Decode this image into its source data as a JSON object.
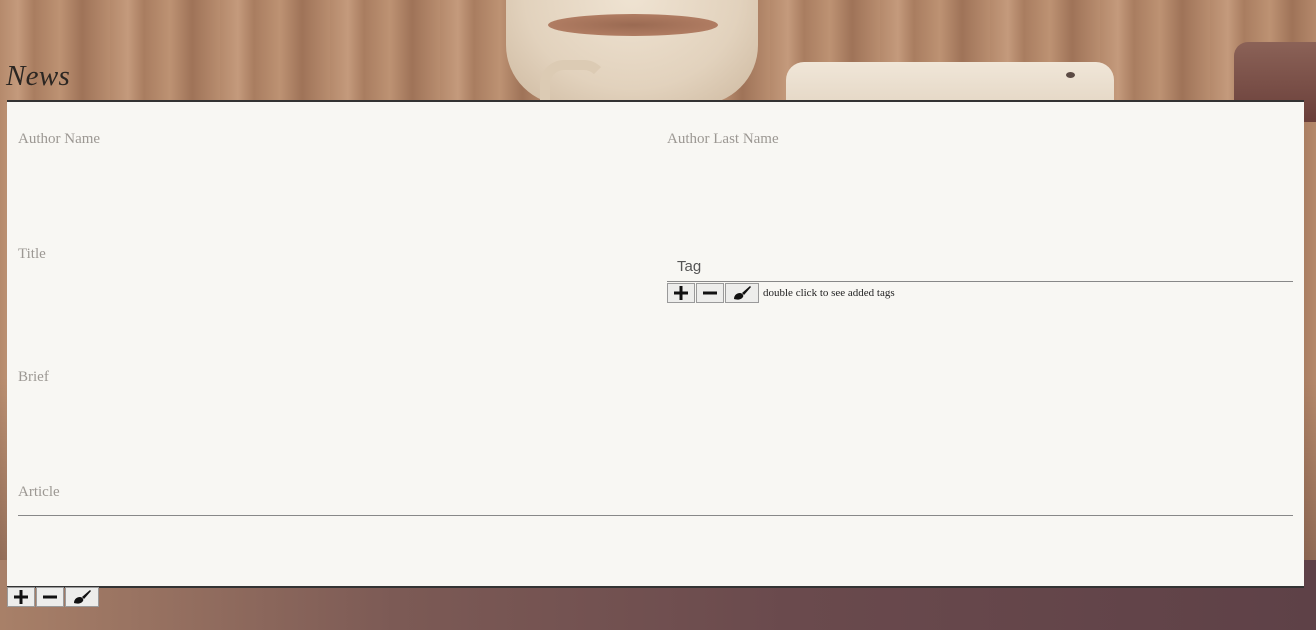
{
  "header": {
    "title": "News"
  },
  "form": {
    "author_name_label": "Author Name",
    "author_last_name_label": "Author Last Name",
    "title_label": "Title",
    "tag_placeholder": "Tag",
    "tag_hint": "double click to see added tags",
    "brief_label": "Brief",
    "article_label": "Article"
  },
  "icons": {
    "add": "plus-icon",
    "remove": "minus-icon",
    "clear": "brush-icon"
  },
  "colors": {
    "panel_bg": "#f8f7f3",
    "label_gray": "#9c9893",
    "border_dark": "#333333"
  }
}
